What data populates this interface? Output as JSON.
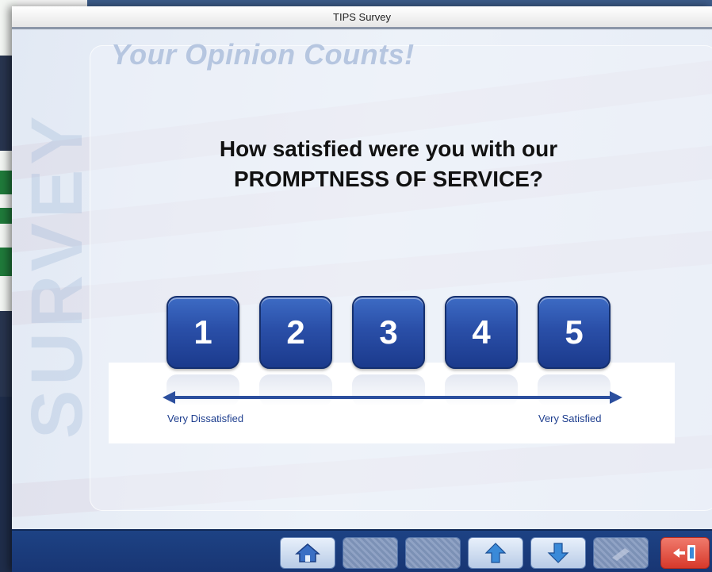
{
  "window": {
    "title": "TIPS Survey"
  },
  "heading": "Your Opinion Counts!",
  "watermark": "SURVEY",
  "question": {
    "line1": "How satisfied were you with our",
    "line2": "PROMPTNESS OF SERVICE?"
  },
  "ratings": [
    "1",
    "2",
    "3",
    "4",
    "5"
  ],
  "scale": {
    "low_label": "Very Dissatisfied",
    "high_label": "Very Satisfied"
  },
  "toolbar": {
    "buttons": [
      {
        "name": "home",
        "icon": "house-icon",
        "state": "enabled"
      },
      {
        "name": "back",
        "icon": "none",
        "state": "disabled"
      },
      {
        "name": "forward",
        "icon": "none",
        "state": "disabled"
      },
      {
        "name": "up",
        "icon": "arrow-up-icon",
        "state": "enabled"
      },
      {
        "name": "down",
        "icon": "arrow-down-icon",
        "state": "enabled"
      },
      {
        "name": "tools",
        "icon": "pencil-icon",
        "state": "disabled"
      },
      {
        "name": "exit",
        "icon": "exit-icon",
        "state": "enabled"
      }
    ]
  },
  "colors": {
    "button_blue": "#2a4fa8",
    "toolbar": "#1d4284",
    "exit_red": "#d7392b",
    "label_blue": "#1f3f8f"
  }
}
